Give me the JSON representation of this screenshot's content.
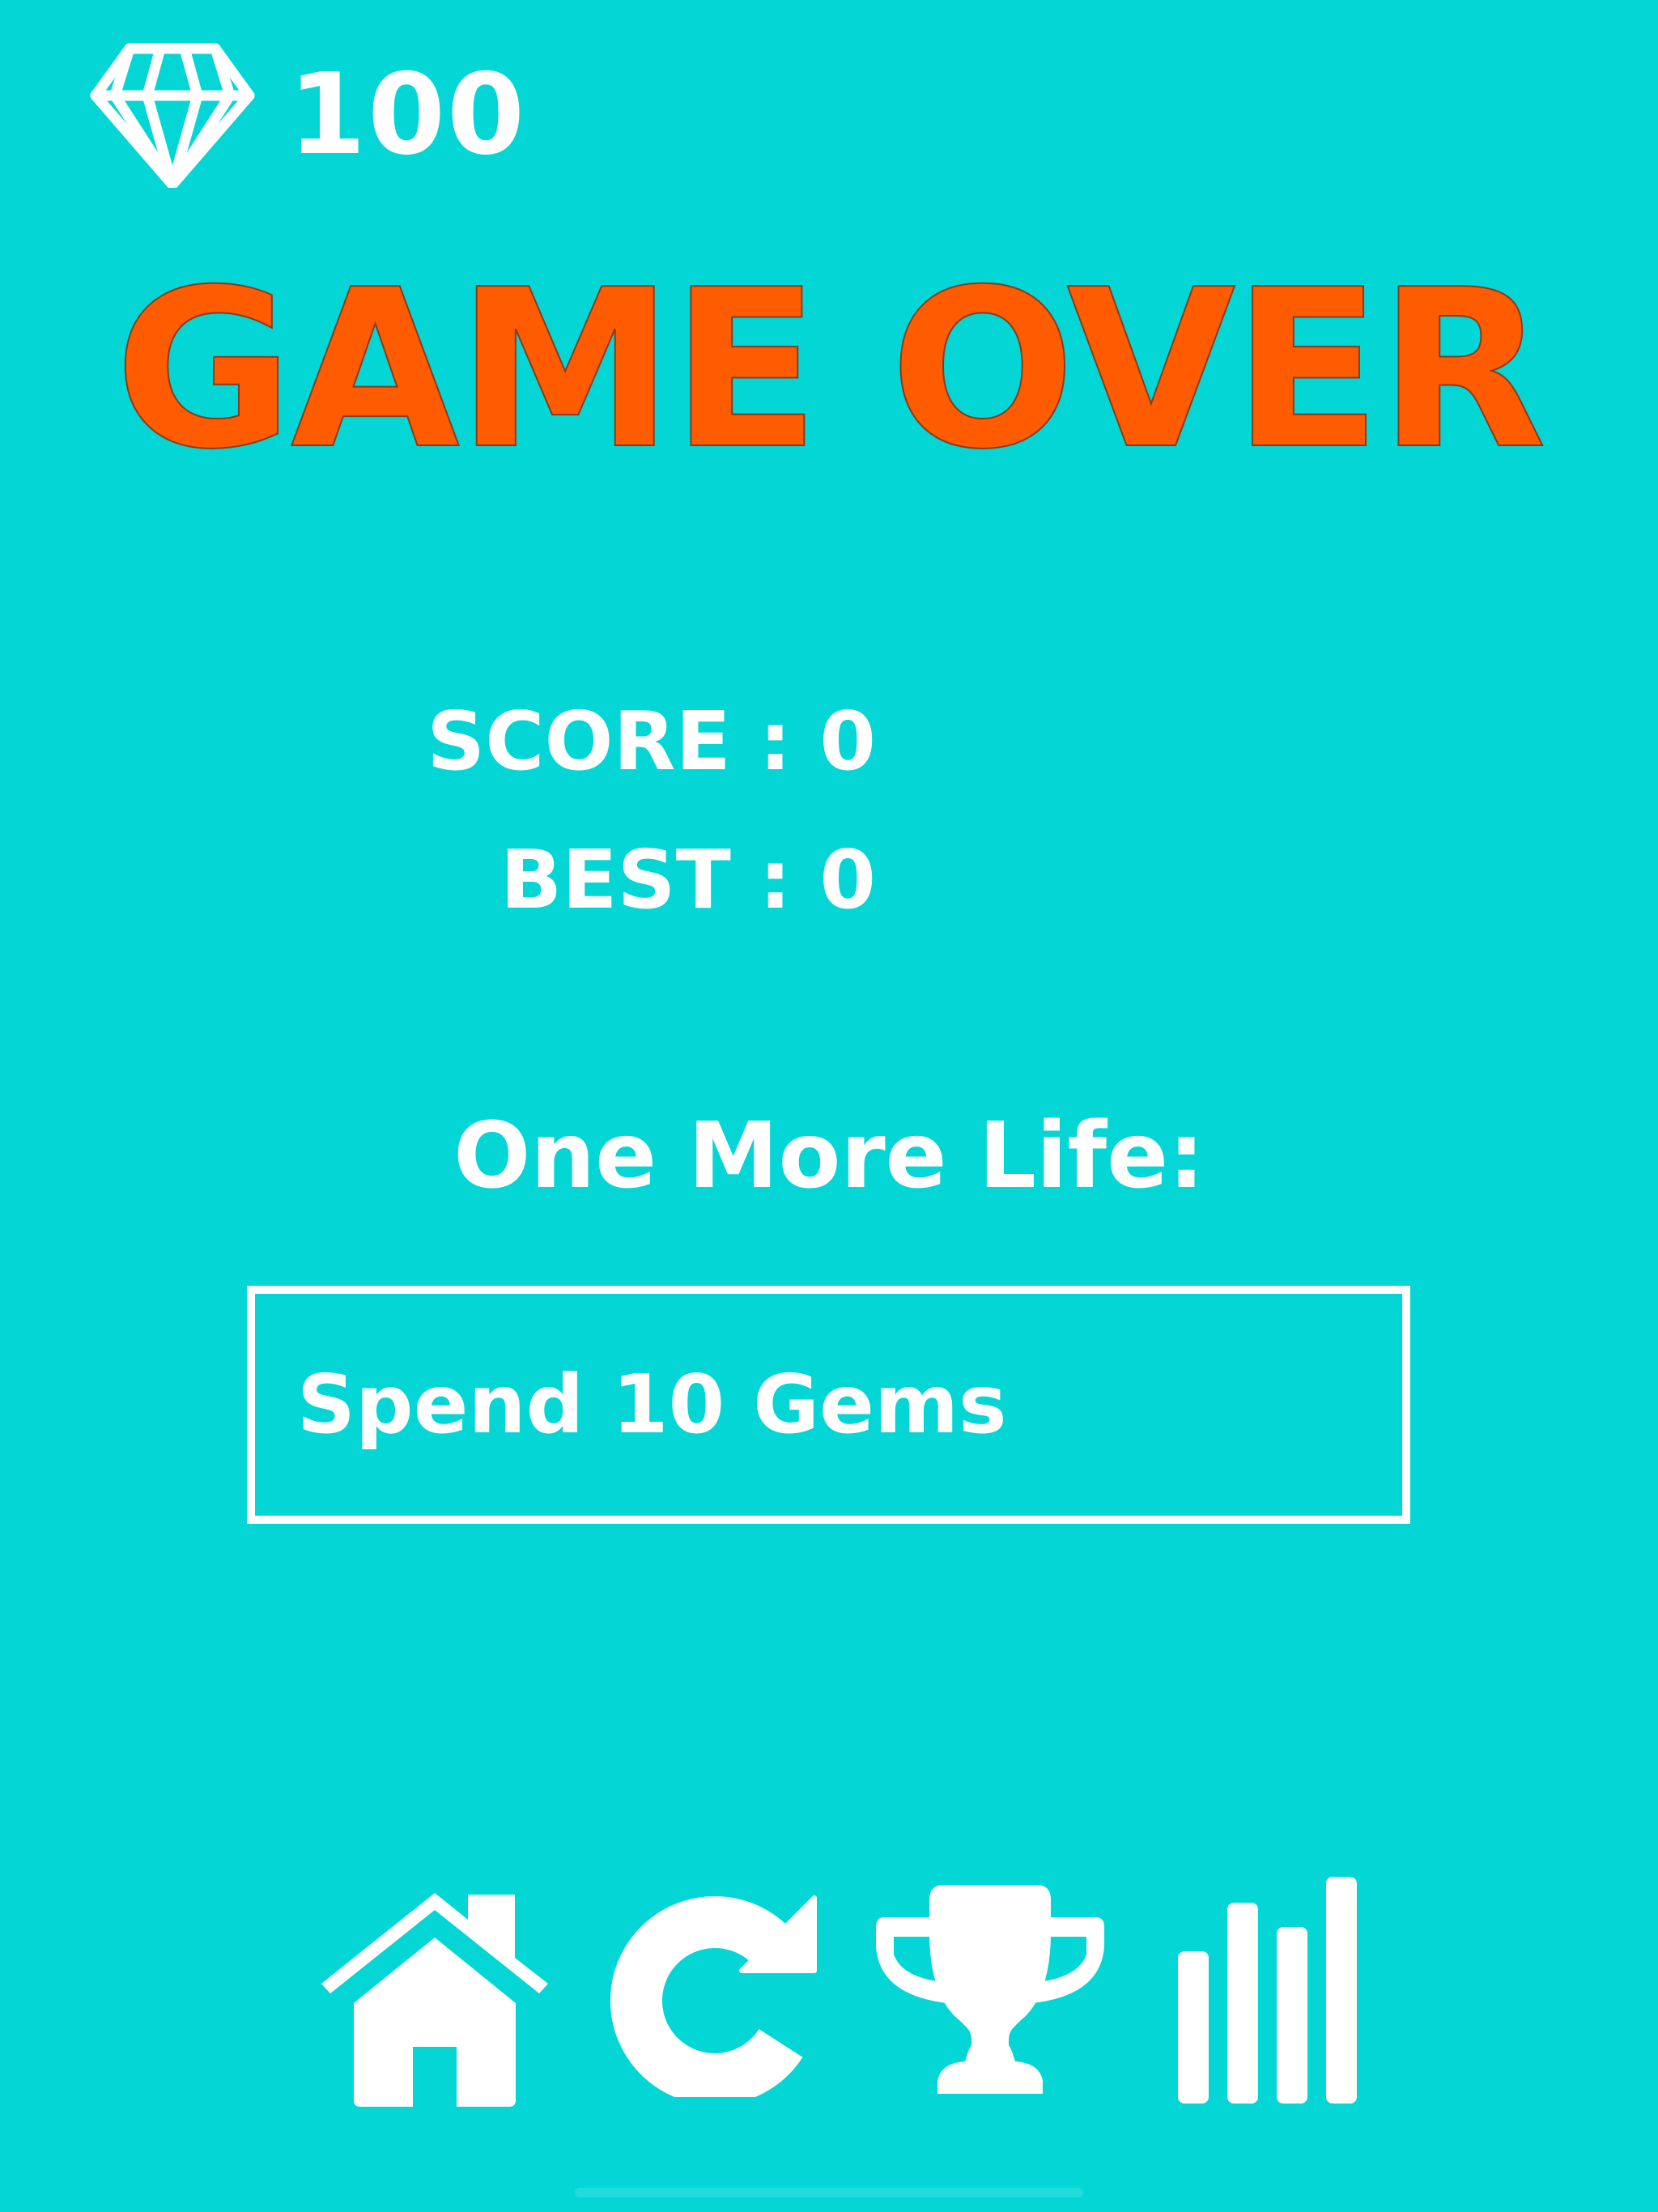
{
  "hud": {
    "gem_icon": "diamond-gem-icon",
    "gem_count": "100"
  },
  "title": "GAME OVER",
  "results": {
    "score_text": "SCORE : 0",
    "best_text": "BEST : 0"
  },
  "continue_offer": {
    "heading": "One More Life:",
    "spend_button_label": "Spend 10 Gems"
  },
  "bottom_nav": [
    {
      "icon": "home-icon"
    },
    {
      "icon": "restart-icon"
    },
    {
      "icon": "trophy-icon"
    },
    {
      "icon": "stats-bars-icon"
    }
  ],
  "colors": {
    "background": "#04D6D6",
    "title": "#FF5B00",
    "foreground": "#FFFFFF"
  }
}
